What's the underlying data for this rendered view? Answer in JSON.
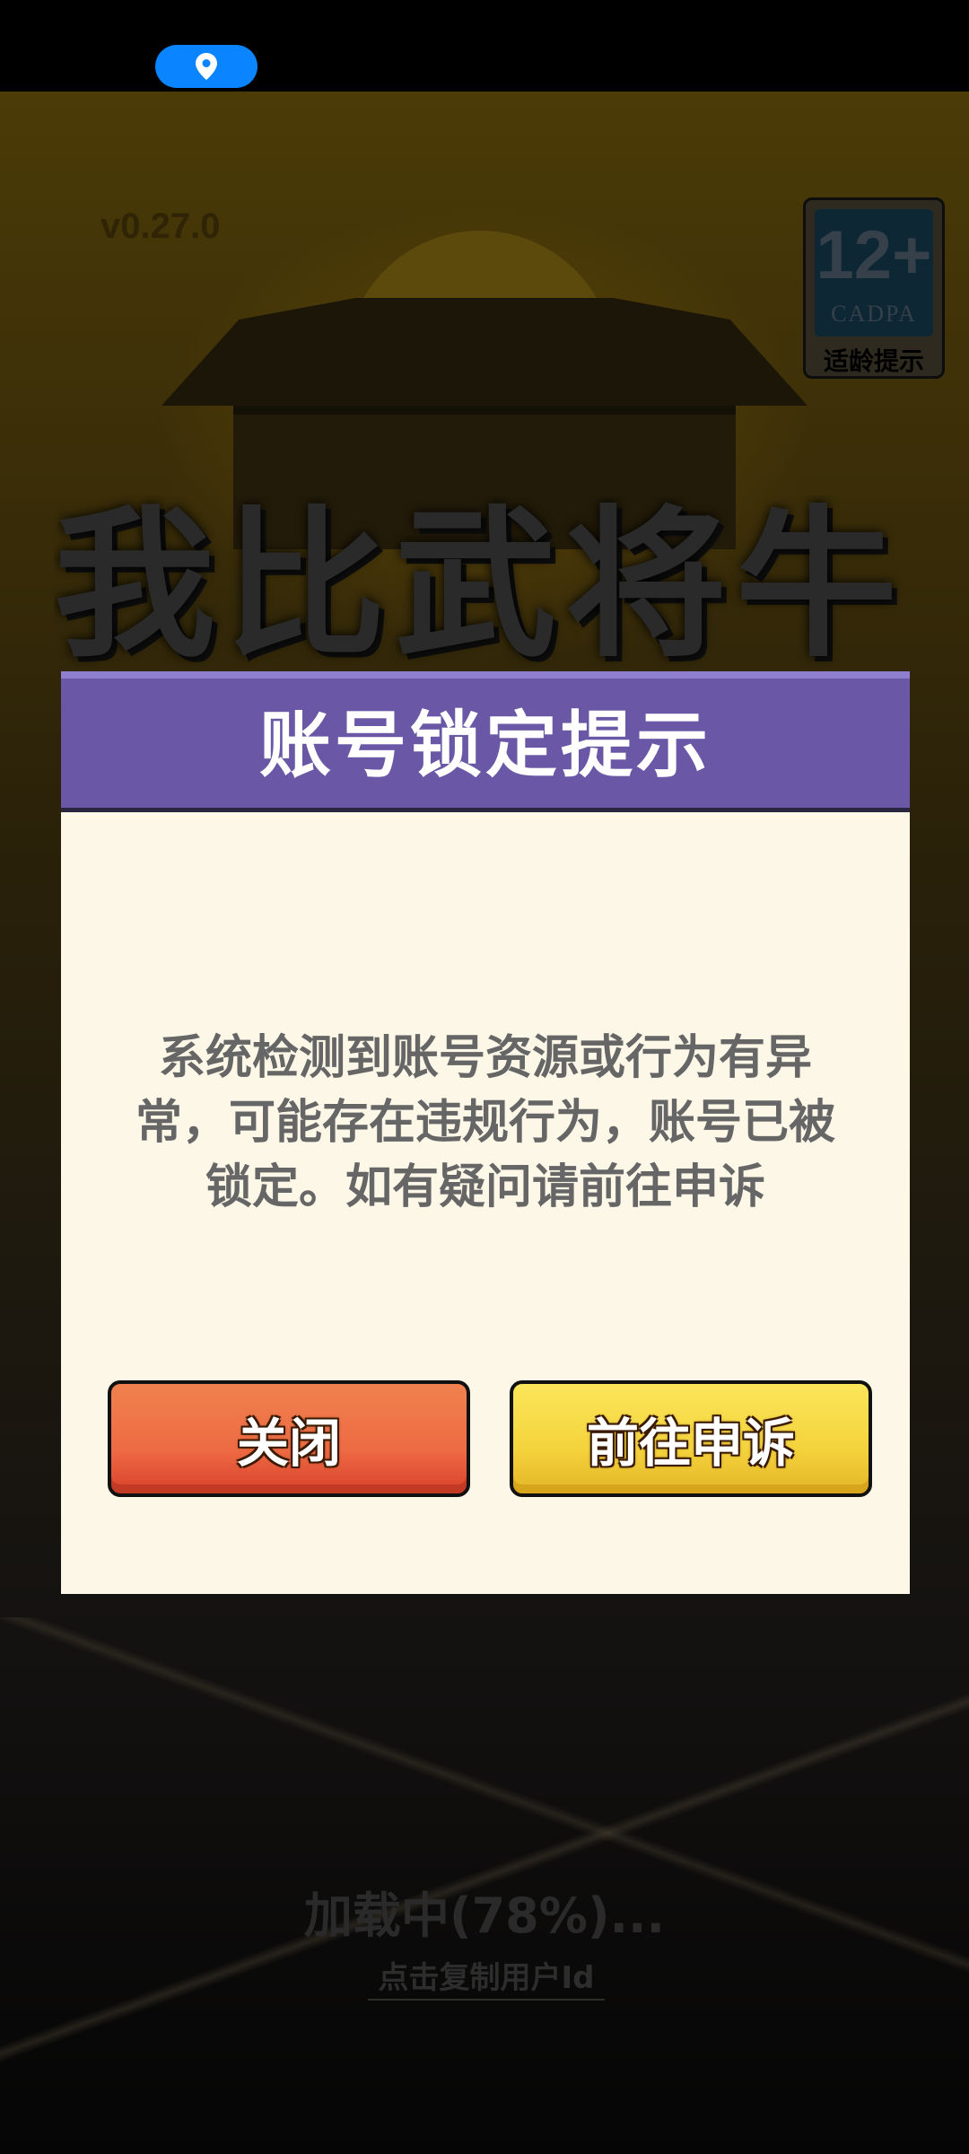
{
  "status_bar": {
    "location_icon": "location-pin-icon"
  },
  "game": {
    "version": "v0.27.0",
    "title_art": "我比武将牛",
    "age_rating": {
      "number": "12+",
      "org": "CADPA",
      "caption": "适龄提示"
    },
    "loading_text": "加载中(78%)...",
    "copy_user_id": "点击复制用户Id"
  },
  "modal": {
    "title": "账号锁定提示",
    "message": "系统检测到账号资源或行为有异常，可能存在违规行为，账号已被锁定。如有疑问请前往申诉",
    "buttons": {
      "close": "关闭",
      "appeal": "前往申诉"
    }
  },
  "colors": {
    "header": "#6a58a6",
    "modal_bg": "#fdf7e8",
    "close_button": "#ee6b43",
    "appeal_button": "#f4d33c",
    "location_pill": "#0a84ff"
  }
}
